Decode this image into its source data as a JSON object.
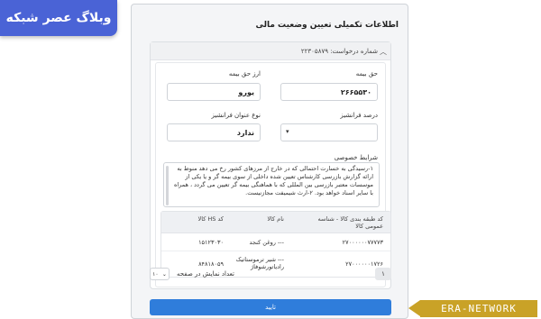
{
  "watermarks": {
    "top_left": "وبلاگ عصر شبکه",
    "bottom_right": "ERA-NETWORK"
  },
  "panel": {
    "title": "اطلاعات تکمیلی تعیین وضعیت مالی",
    "section_header": "شماره درخواست: ۲۲۳۰۵۸۷۹",
    "fields": {
      "premium_label": "حق بیمه",
      "premium_value": "۲۶۶۵۵۳۰",
      "currency_label": "ارز حق بیمه",
      "currency_value": "یورو",
      "franchise_percent_label": "درصد فرانشیز",
      "franchise_percent_value": "",
      "franchise_type_label": "نوع عنوان فرانشیز",
      "franchise_type_value": "ندارد"
    },
    "conditions_label": "شرایط خصوصی",
    "conditions_text": "۱-رسیدگی به خسارت احتمالی که در خارج از مرزهای کشور رخ می دهد منوط به ارائه گزارش بازرسی کارشناس تعیین شده داخلی از سوی بیمه گر و یا یکی از موسسات معتبر بازرسی بین المللی که با هماهنگی بیمه گر تعیین می گردد ، همراه با سایر اسناد خواهد بود. ۲-ارث شیمیفت مجازنیست.",
    "table": {
      "headers": {
        "code": "کد طبقه بندی کالا - شناسه عمومی کالا",
        "name": "نام کالا",
        "hs": "کد HS کالا"
      },
      "rows": [
        {
          "code": "۲۷۰۰۰۰۰۰۷۷۷۷۳",
          "name": "--- روغن کنجد",
          "hs": "۱۵۱۲۳۰۳۰"
        },
        {
          "code": "۲۷۰۰۰۰۰۰۱۷۲۶",
          "name": "--- شیر ترموستاتیک رادیاتورشوفاژ",
          "hs": "۸۴۸۱۸۰۵۹"
        }
      ]
    },
    "pager": {
      "current_page": "۱",
      "page_size": "۱۰",
      "page_size_label": "تعداد نمایش در صفحه"
    },
    "confirm_label": "تایید"
  },
  "colors": {
    "primary": "#2f7ddb",
    "badge_blue": "#4a63d6",
    "badge_gold": "#c9a227"
  }
}
